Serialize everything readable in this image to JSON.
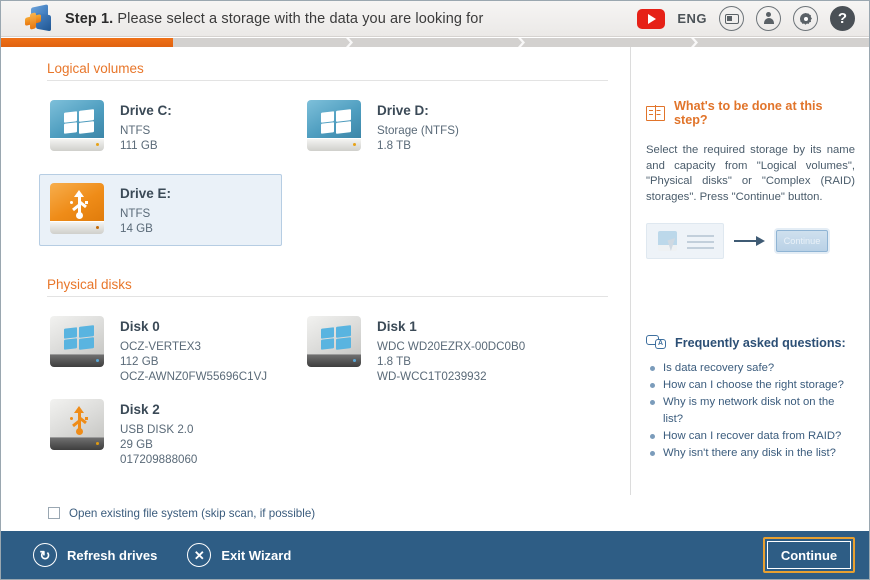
{
  "header": {
    "logo_icon": "app-logo-icon",
    "step_label": "Step 1.",
    "step_text": "Please select a storage with the data you are looking for",
    "youtube_icon": "youtube-icon",
    "language": "ENG",
    "icons": [
      "card-icon",
      "person-icon",
      "gear-icon"
    ],
    "help_label": "?"
  },
  "progress": {
    "fill_percent": 20,
    "fill_color": "#ef7117",
    "track_color": "#d3d1cf"
  },
  "sections": {
    "logical": {
      "title": "Logical volumes",
      "items": [
        {
          "name": "Drive C:",
          "icon": "windows-drive-icon",
          "style": "blue",
          "lines": [
            "NTFS",
            "111 GB"
          ],
          "selected": false
        },
        {
          "name": "Drive D:",
          "icon": "windows-drive-icon",
          "style": "blue",
          "lines": [
            "Storage (NTFS)",
            "1.8 TB"
          ],
          "selected": false
        },
        {
          "name": "Drive E:",
          "icon": "usb-drive-icon",
          "style": "orange",
          "lines": [
            "NTFS",
            "14 GB"
          ],
          "selected": true
        }
      ]
    },
    "physical": {
      "title": "Physical disks",
      "items": [
        {
          "name": "Disk 0",
          "icon": "windows-disk-icon",
          "style": "grey",
          "lines": [
            "OCZ-VERTEX3",
            "112 GB",
            "OCZ-AWNZ0FW55696C1VJ"
          ],
          "selected": false
        },
        {
          "name": "Disk 1",
          "icon": "windows-disk-icon",
          "style": "grey",
          "lines": [
            "WDC WD20EZRX-00DC0B0",
            "1.8 TB",
            "WD-WCC1T0239932"
          ],
          "selected": false
        },
        {
          "name": "Disk 2",
          "icon": "usb-disk-icon",
          "style": "greyo",
          "lines": [
            "USB DISK 2.0",
            "29 GB",
            "017209888060"
          ],
          "selected": false
        }
      ]
    }
  },
  "help_panel": {
    "icon": "book-icon",
    "title": "What's to be done at this step?",
    "text": "Select the required storage by its name and capacity from \"Logical volumes\", \"Physical disks\" or \"Complex (RAID) storages\". Press \"Continue\" button.",
    "illustration": {
      "cursor_icon": "cursor-icon",
      "arrow_icon": "arrow-right-icon",
      "button_label": "Continue"
    }
  },
  "faq": {
    "icon": "faq-icon",
    "title": "Frequently asked questions:",
    "items": [
      "Is data recovery safe?",
      "How can I choose the right storage?",
      "Why is my network disk not on the list?",
      "How can I recover data from RAID?",
      "Why isn't there any disk in the list?"
    ]
  },
  "options": {
    "open_existing_label": "Open existing file system (skip scan, if possible)",
    "open_existing_checked": false
  },
  "footer": {
    "refresh_icon": "refresh-icon",
    "refresh_label": "Refresh drives",
    "exit_icon": "close-icon",
    "exit_label": "Exit Wizard",
    "continue_label": "Continue",
    "bar_color": "#2e5d85",
    "focus_color": "#e8a030"
  }
}
